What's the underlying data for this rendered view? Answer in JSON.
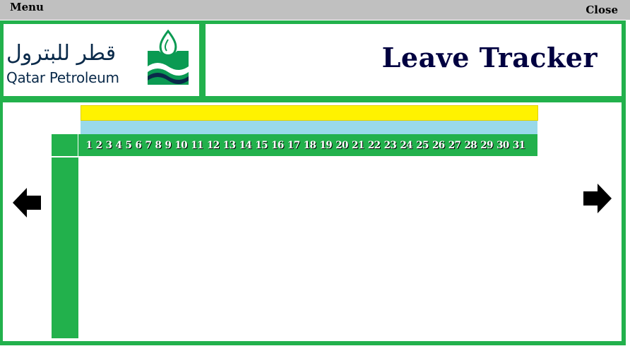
{
  "topbar": {
    "menu_label": "Menu",
    "close_label": "Close"
  },
  "header": {
    "logo": {
      "english": "Qatar Petroleum",
      "arabic": "قطر للبترول"
    },
    "title": "Leave Tracker"
  },
  "calendar": {
    "days": [
      "1",
      "2",
      "3",
      "4",
      "5",
      "6",
      "7",
      "8",
      "9",
      "10",
      "11",
      "12",
      "13",
      "14",
      "15",
      "16",
      "17",
      "18",
      "19",
      "20",
      "21",
      "22",
      "23",
      "24",
      "25",
      "26",
      "27",
      "28",
      "29",
      "30",
      "31"
    ]
  },
  "nav": {
    "prev_icon": "arrow-left-icon",
    "next_icon": "arrow-right-icon"
  },
  "colors": {
    "frame": "#22b14c",
    "month_bar": "#fff200",
    "week_bar": "#99d9ea",
    "title": "#000040",
    "topbar": "#c0c0c0"
  }
}
